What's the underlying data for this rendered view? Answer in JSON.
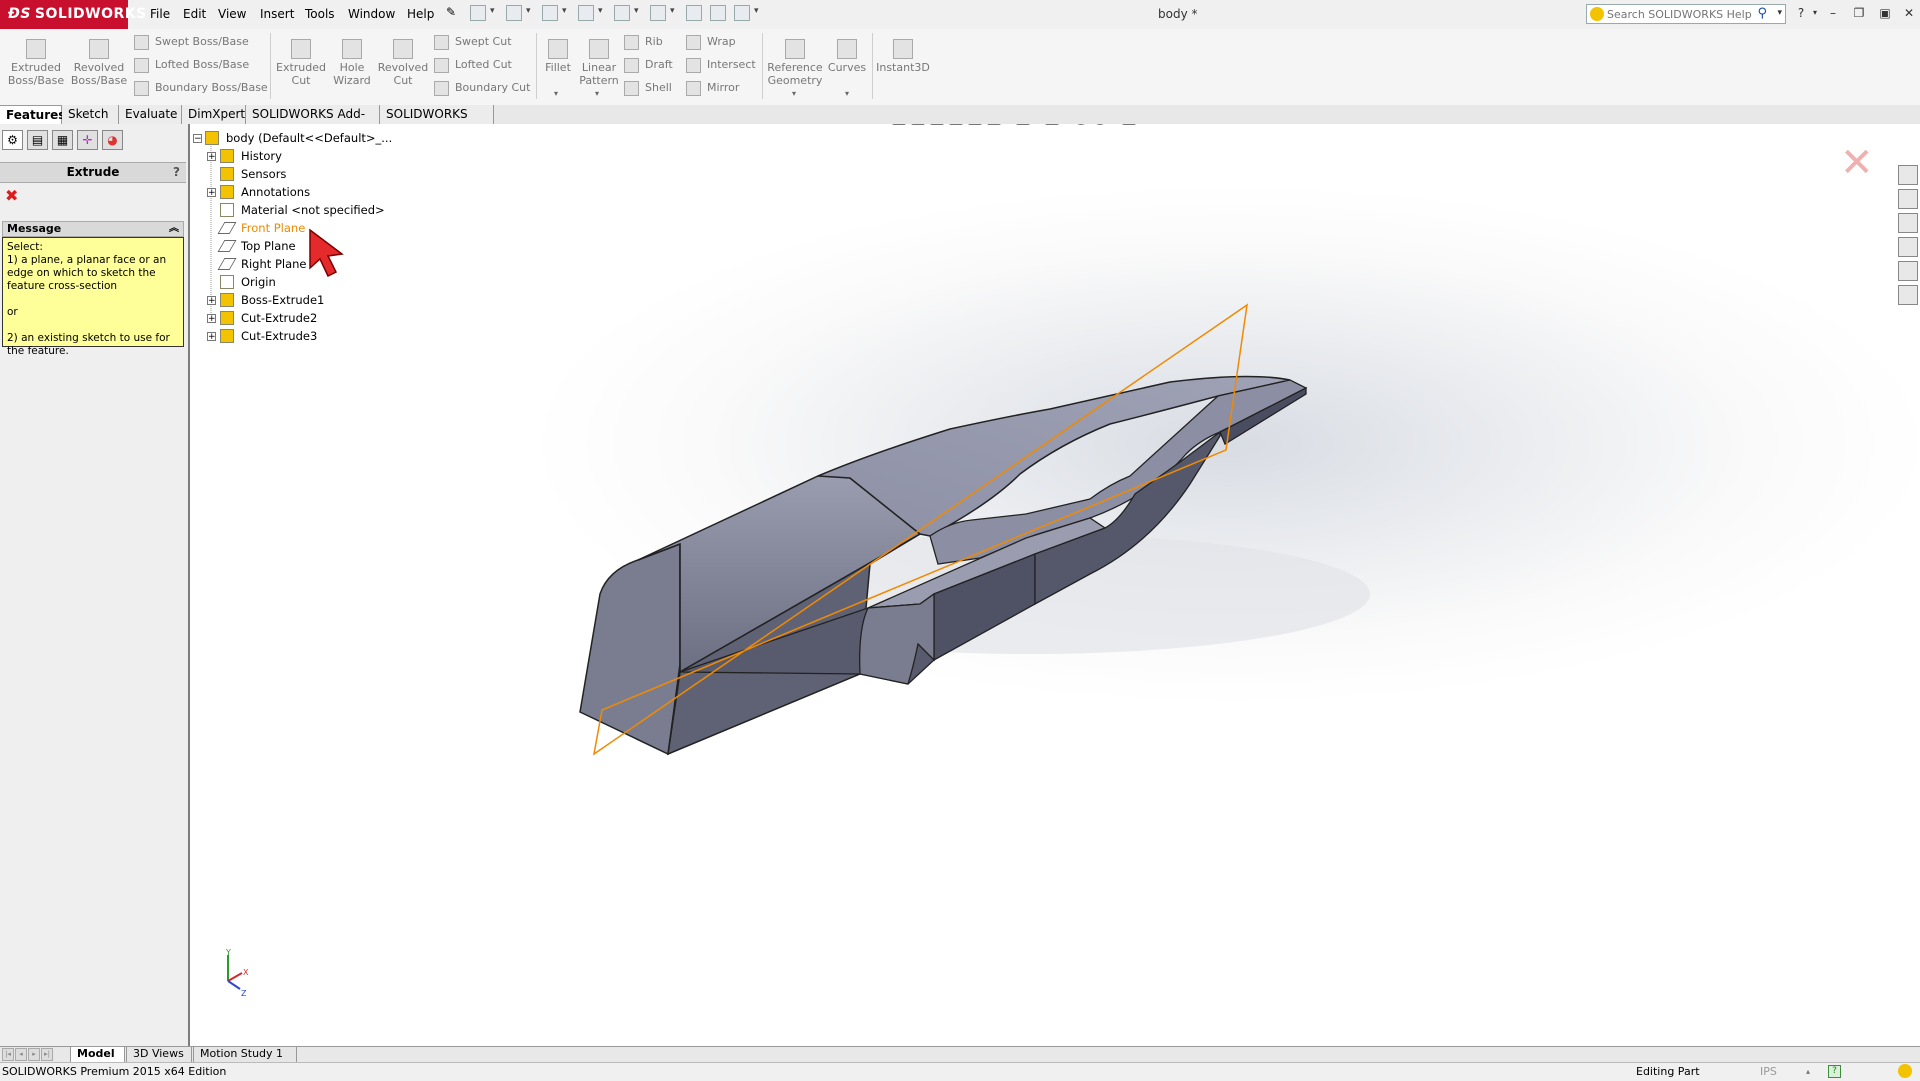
{
  "app": {
    "brand": "SOLIDWORKS",
    "document_title": "body *"
  },
  "menu": [
    "File",
    "Edit",
    "View",
    "Insert",
    "Tools",
    "Window",
    "Help"
  ],
  "search": {
    "placeholder": "Search SOLIDWORKS Help"
  },
  "command_manager": {
    "extruded_boss": "Extruded\nBoss/Base",
    "revolved_boss": "Revolved\nBoss/Base",
    "swept_boss": "Swept Boss/Base",
    "lofted_boss": "Lofted Boss/Base",
    "boundary_boss": "Boundary Boss/Base",
    "extruded_cut": "Extruded\nCut",
    "hole_wizard": "Hole\nWizard",
    "revolved_cut": "Revolved\nCut",
    "swept_cut": "Swept Cut",
    "lofted_cut": "Lofted Cut",
    "boundary_cut": "Boundary Cut",
    "fillet": "Fillet",
    "linear_pattern": "Linear\nPattern",
    "rib": "Rib",
    "draft": "Draft",
    "shell": "Shell",
    "wrap": "Wrap",
    "intersect": "Intersect",
    "mirror": "Mirror",
    "reference_geometry": "Reference\nGeometry",
    "curves": "Curves",
    "instant3d": "Instant3D"
  },
  "tabs": [
    "Features",
    "Sketch",
    "Evaluate",
    "DimXpert",
    "SOLIDWORKS Add-Ins",
    "SOLIDWORKS MBD"
  ],
  "property_manager": {
    "title": "Extrude",
    "help": "?",
    "message_header": "Message",
    "message_body": "Select:\n1) a plane, a planar face or an edge on which to sketch the feature cross-section\n\nor\n\n2) an existing sketch to use for the feature."
  },
  "feature_tree": {
    "root": "body  (Default<<Default>_...",
    "items": [
      {
        "label": "History",
        "expandable": true,
        "icon": "history-icon"
      },
      {
        "label": "Sensors",
        "expandable": false,
        "icon": "sensors-icon"
      },
      {
        "label": "Annotations",
        "expandable": true,
        "icon": "annotations-icon"
      },
      {
        "label": "Material <not specified>",
        "expandable": false,
        "icon": "material-icon"
      },
      {
        "label": "Front Plane",
        "expandable": false,
        "icon": "plane-icon",
        "highlighted": true
      },
      {
        "label": "Top Plane",
        "expandable": false,
        "icon": "plane-icon"
      },
      {
        "label": "Right Plane",
        "expandable": false,
        "icon": "plane-icon"
      },
      {
        "label": "Origin",
        "expandable": false,
        "icon": "origin-icon"
      },
      {
        "label": "Boss-Extrude1",
        "expandable": true,
        "icon": "extrude-feature-icon"
      },
      {
        "label": "Cut-Extrude2",
        "expandable": true,
        "icon": "cut-feature-icon"
      },
      {
        "label": "Cut-Extrude3",
        "expandable": true,
        "icon": "cut-feature-icon"
      }
    ]
  },
  "bottom_tabs": [
    "Model",
    "3D Views",
    "Motion Study 1"
  ],
  "status": {
    "left": "SOLIDWORKS Premium 2015 x64 Edition",
    "editing": "Editing Part",
    "units": "IPS"
  },
  "colors": {
    "brand_red": "#c8102e",
    "highlight_orange": "#f08a00",
    "plane_orange": "#f08a00",
    "model_gray": "#7c7f92",
    "message_yellow": "#ffff99"
  }
}
